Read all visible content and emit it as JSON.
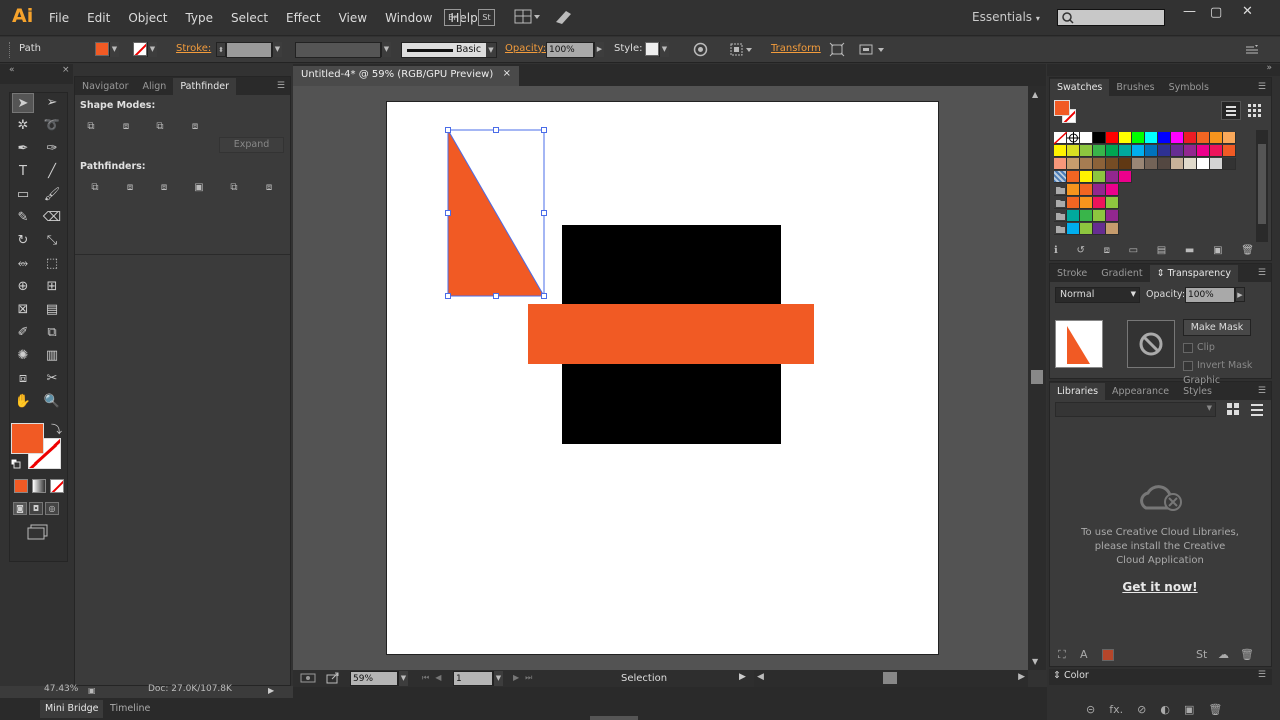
{
  "app": {
    "logo": "Ai"
  },
  "menu": [
    "File",
    "Edit",
    "Object",
    "Type",
    "Select",
    "Effect",
    "View",
    "Window",
    "Help"
  ],
  "bridge_icons": [
    {
      "label": "Br",
      "icon": "bridge-icon"
    },
    {
      "label": "St",
      "icon": "stock-icon"
    },
    {
      "label": "",
      "icon": "arrange-documents-icon"
    },
    {
      "label": "",
      "icon": "gpu-performance-icon"
    }
  ],
  "workspace": {
    "label": "Essentials"
  },
  "window_controls": [
    "minimize-icon",
    "restore-icon",
    "close-icon"
  ],
  "control_bar": {
    "object_type": "Path",
    "fill_color": "#f15a24",
    "stroke_label": "Stroke:",
    "brush_label": "Basic",
    "opacity_label": "Opacity:",
    "opacity_value": "100%",
    "style_label": "Style:",
    "transform_label": "Transform"
  },
  "document_tab": {
    "title": "Untitled-4* @ 59% (RGB/GPU Preview)",
    "close": "×"
  },
  "left_panel": {
    "tabs": [
      "Navigator",
      "Align",
      "Pathfinder"
    ],
    "active_tab": "Pathfinder",
    "shape_modes_label": "Shape Modes:",
    "pathfinders_label": "Pathfinders:",
    "expand_label": "Expand"
  },
  "tools": [
    [
      "selection-tool-icon",
      "direct-selection-tool-icon"
    ],
    [
      "magic-wand-tool-icon",
      "lasso-tool-icon"
    ],
    [
      "pen-tool-icon",
      "curvature-tool-icon"
    ],
    [
      "type-tool-icon",
      "line-segment-tool-icon"
    ],
    [
      "rectangle-tool-icon",
      "paintbrush-tool-icon"
    ],
    [
      "pencil-tool-icon",
      "eraser-tool-icon"
    ],
    [
      "rotate-tool-icon",
      "scale-tool-icon"
    ],
    [
      "width-tool-icon",
      "free-transform-tool-icon"
    ],
    [
      "shape-builder-tool-icon",
      "perspective-grid-tool-icon"
    ],
    [
      "mesh-tool-icon",
      "gradient-tool-icon"
    ],
    [
      "eyedropper-tool-icon",
      "blend-tool-icon"
    ],
    [
      "symbol-sprayer-tool-icon",
      "column-graph-tool-icon"
    ],
    [
      "artboard-tool-icon",
      "slice-tool-icon"
    ],
    [
      "hand-tool-icon",
      "zoom-tool-icon"
    ]
  ],
  "colors": {
    "fill": "#f15a24",
    "artboard": "#ffffff",
    "square": "#000000",
    "selection": "#4a6ce8",
    "accent_label": "#f39c3c"
  },
  "status_bar": {
    "zoom": "59%",
    "artboard_number": "1",
    "tool_name": "Selection"
  },
  "bottom_bar": {
    "zoom_readout": "47.43%",
    "doc_size": "Doc: 27.0K/107.8K",
    "tabs": [
      "Mini Bridge",
      "Timeline"
    ]
  },
  "swatches_panel": {
    "tabs": [
      "Swatches",
      "Brushes",
      "Symbols"
    ]
  },
  "transparency_panel": {
    "tabs": [
      "Stroke",
      "Gradient",
      "Transparency"
    ],
    "blend_mode": "Normal",
    "opacity_label": "Opacity:",
    "opacity_value": "100%",
    "make_mask": "Make Mask",
    "clip": "Clip",
    "invert_mask": "Invert Mask"
  },
  "libraries_panel": {
    "tabs": [
      "Libraries",
      "Appearance",
      "Graphic Styles"
    ],
    "message": "To use Creative Cloud Libraries, please install the Creative Cloud Application",
    "link": "Get it now!"
  },
  "color_panel": {
    "tab": "Color"
  }
}
